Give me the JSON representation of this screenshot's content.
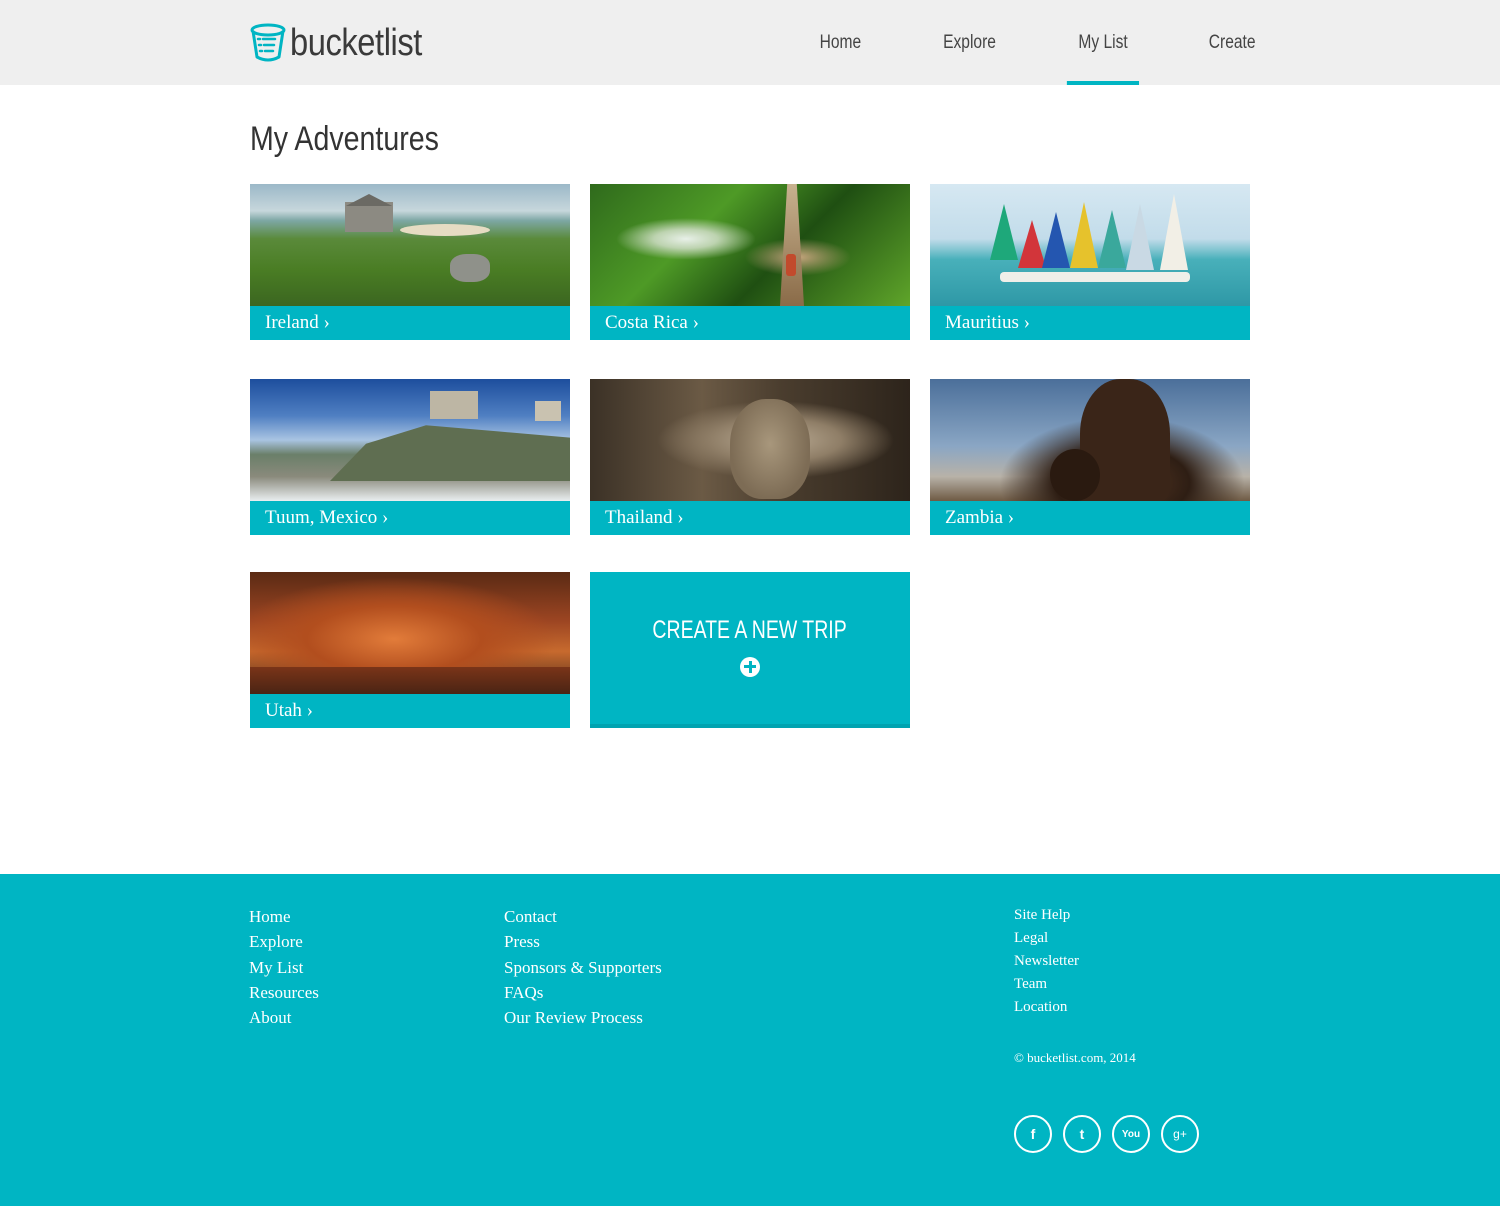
{
  "brand": {
    "name": "bucketlist",
    "accent": "#00b5c3",
    "header_bg": "#efefef"
  },
  "nav": {
    "items": [
      {
        "label": "Home",
        "active": false
      },
      {
        "label": "Explore",
        "active": false
      },
      {
        "label": "My List",
        "active": true
      },
      {
        "label": "Create",
        "active": false
      }
    ]
  },
  "page": {
    "title": "My Adventures"
  },
  "trips": [
    {
      "label": "Ireland ›",
      "image": "green coastal hills with stone cottage"
    },
    {
      "label": "Costa Rica ›",
      "image": "jungle waterfall and hanging bridge"
    },
    {
      "label": "Mauritius ›",
      "image": "colorful sailboats on lagoon"
    },
    {
      "label": "Tuum, Mexico ›",
      "image": "cliffside ruins above the sea"
    },
    {
      "label": "Thailand ›",
      "image": "stone buddha head in tree roots"
    },
    {
      "label": "Zambia ›",
      "image": "children at sunset"
    },
    {
      "label": "Utah ›",
      "image": "red sandstone canyon alcove"
    }
  ],
  "create_card": {
    "label": "CREATE A NEW TRIP",
    "icon": "plus-circle-icon"
  },
  "footer": {
    "col1": [
      "Home",
      "Explore",
      "My List",
      "Resources",
      "About"
    ],
    "col2": [
      "Contact",
      "Press",
      "Sponsors & Supporters",
      "FAQs",
      "Our Review Process"
    ],
    "col3": [
      "Site Help",
      "Legal",
      "Newsletter",
      "Team",
      "Location"
    ],
    "copyright": "© bucketlist.com, 2014",
    "social": [
      {
        "icon": "facebook-icon",
        "glyph": "f"
      },
      {
        "icon": "twitter-icon",
        "glyph": "t"
      },
      {
        "icon": "youtube-icon",
        "glyph": "You"
      },
      {
        "icon": "google-plus-icon",
        "glyph": "g+"
      }
    ]
  }
}
